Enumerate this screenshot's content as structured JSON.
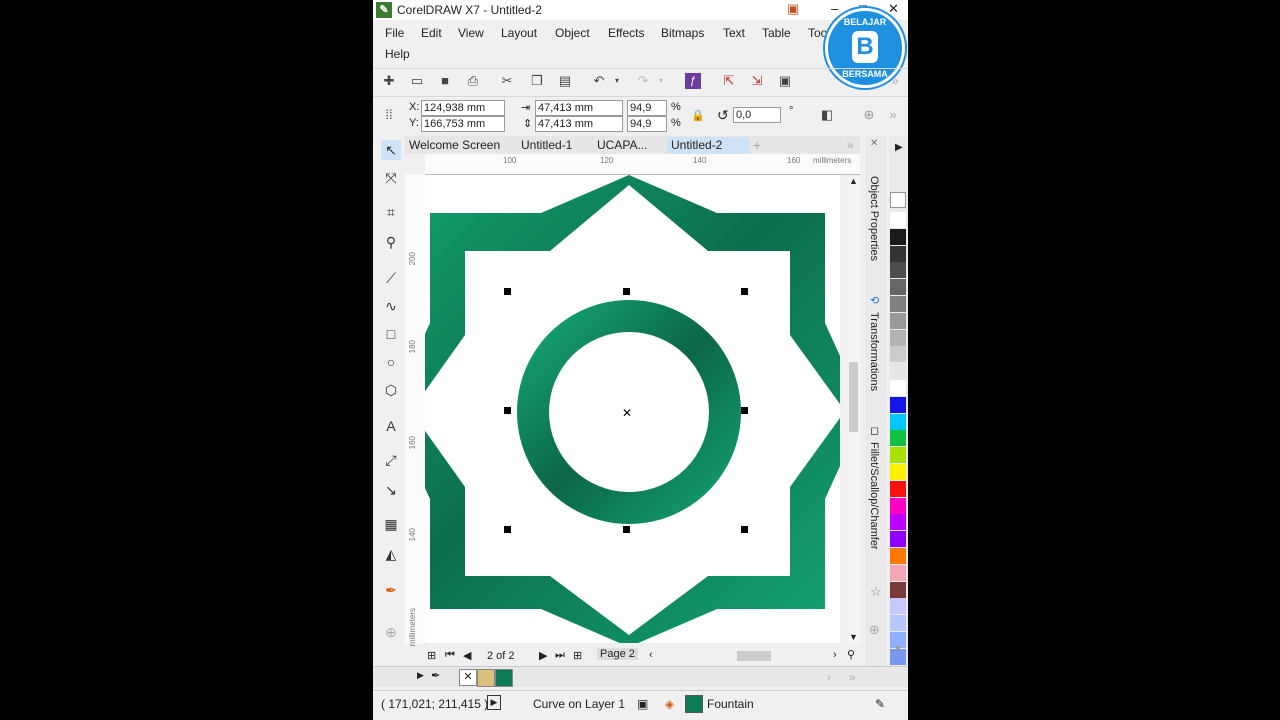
{
  "window": {
    "title": "CorelDRAW X7 - Untitled-2",
    "app_icon": "coreldraw-icon",
    "minimize": "–",
    "maximize": "□",
    "close": "✕"
  },
  "menu": {
    "items": [
      "File",
      "Edit",
      "View",
      "Layout",
      "Object",
      "Effects",
      "Bitmaps",
      "Text",
      "Table",
      "Too"
    ],
    "help": "Help"
  },
  "watermark": {
    "line1": "BELAJAR",
    "line2": "BERSAMA",
    "letter": "B",
    "color": "#1f8fe0"
  },
  "properties": {
    "x_label": "X:",
    "x_value": "124,938 mm",
    "y_label": "Y:",
    "y_value": "166,753 mm",
    "width_value": "47,413 mm",
    "height_value": "47,413 mm",
    "scale_w": "94,9",
    "scale_h": "94,9",
    "percent": "%",
    "rotation": "0,0",
    "degree": "°"
  },
  "tabs": [
    "Welcome Screen",
    "Untitled-1",
    "UCAPA...",
    "Untitled-2"
  ],
  "ruler": {
    "unit": "millimeters",
    "h_ticks": [
      "100",
      "120",
      "140",
      "160"
    ],
    "v_ticks": [
      "200",
      "180",
      "160",
      "140"
    ],
    "v_unit": "millimeters"
  },
  "dockers": [
    "Object Properties",
    "Transformations",
    "Fillet/Scallop/Chamfer"
  ],
  "palette_colors": [
    "#ffffff",
    "#1a1a1a",
    "#333333",
    "#4d4d4d",
    "#666666",
    "#808080",
    "#999999",
    "#b3b3b3",
    "#cccccc",
    "#e6e6e6",
    "#ffffff",
    "#1515e8",
    "#00c8ff",
    "#10c040",
    "#a8e000",
    "#ffef00",
    "#ff1010",
    "#ff00c8",
    "#c000ff",
    "#9000ff",
    "#ff7800",
    "#f3a6b8",
    "#7a3a3a",
    "#c8c8ff",
    "#b8c8ff",
    "#90b0ff",
    "#7898f0",
    "#6080e8"
  ],
  "pagebar": {
    "page_count": "2 of 2",
    "page_tab": "Page 2"
  },
  "doc_palette": [
    "#d9c07c",
    "#0d7a55"
  ],
  "status": {
    "coords": "( 171,021; 211,415 )",
    "object": "Curve on Layer 1",
    "fill_label": "Fountain",
    "fill_color": "#0d7a55"
  },
  "colors": {
    "accent_green": "#0d7a55"
  }
}
